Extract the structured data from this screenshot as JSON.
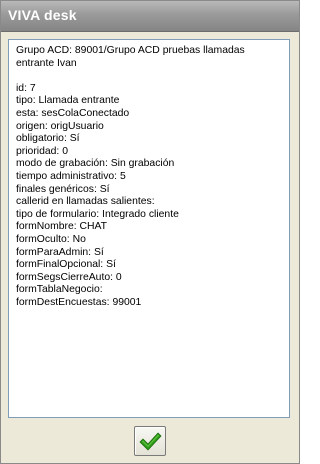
{
  "window": {
    "title": "VIVA desk"
  },
  "info": {
    "header_line1": "Grupo ACD: 89001/Grupo ACD pruebas llamadas",
    "header_line2": "entrante Ivan",
    "fields": [
      "id: 7",
      "tipo: Llamada entrante",
      "esta: sesColaConectado",
      "origen: origUsuario",
      "obligatorio: Sí",
      "prioridad: 0",
      "modo de grabación: Sin grabación",
      "tiempo administrativo: 5",
      "finales genéricos: Sí",
      "callerid en llamadas salientes:",
      "tipo de formulario: Integrado cliente",
      "formNombre: CHAT",
      "formOculto: No",
      "formParaAdmin: Sí",
      "formFinalOpcional: Sí",
      "formSegsCierreAuto: 0",
      "formTablaNegocio:",
      "formDestEncuestas: 99001"
    ]
  },
  "ok_button": {
    "icon": "checkmark-icon",
    "color": "#2e9a1a"
  }
}
